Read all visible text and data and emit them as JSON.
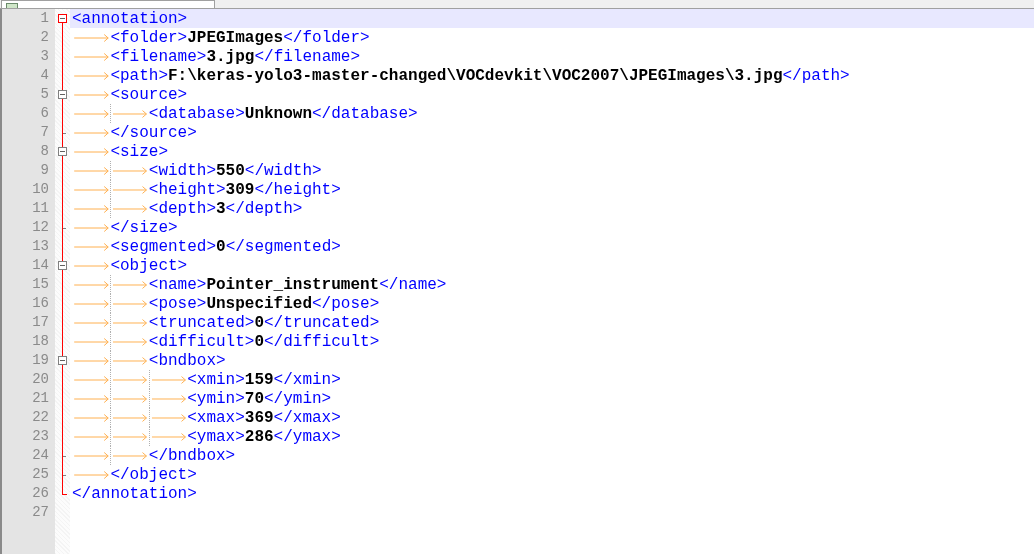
{
  "editor": {
    "lines": [
      {
        "number": "1",
        "current": true,
        "open": [
          {
            "kind": "tag",
            "text": "<annotation>"
          }
        ],
        "close_number": "26",
        "close": [
          {
            "kind": "tag",
            "text": "</annotation>"
          }
        ],
        "children": [
          {
            "number": "2",
            "current": false,
            "open": [
              {
                "kind": "tag",
                "text": "<folder>"
              },
              {
                "kind": "text",
                "text": "JPEGImages"
              },
              {
                "kind": "tag",
                "text": "</folder>"
              }
            ]
          },
          {
            "number": "3",
            "current": false,
            "open": [
              {
                "kind": "tag",
                "text": "<filename>"
              },
              {
                "kind": "text",
                "text": "3.jpg"
              },
              {
                "kind": "tag",
                "text": "</filename>"
              }
            ]
          },
          {
            "number": "4",
            "current": false,
            "open": [
              {
                "kind": "tag",
                "text": "<path>"
              },
              {
                "kind": "text",
                "text": "F:\\keras-yolo3-master-changed\\VOCdevkit\\VOC2007\\JPEGImages\\3.jpg"
              },
              {
                "kind": "tag",
                "text": "</path>"
              }
            ]
          },
          {
            "number": "5",
            "current": false,
            "open": [
              {
                "kind": "tag",
                "text": "<source>"
              }
            ],
            "close_number": "7",
            "close": [
              {
                "kind": "tag",
                "text": "</source>"
              }
            ],
            "children": [
              {
                "number": "6",
                "current": false,
                "open": [
                  {
                    "kind": "tag",
                    "text": "<database>"
                  },
                  {
                    "kind": "text",
                    "text": "Unknown"
                  },
                  {
                    "kind": "tag",
                    "text": "</database>"
                  }
                ]
              }
            ]
          },
          {
            "number": "8",
            "current": false,
            "open": [
              {
                "kind": "tag",
                "text": "<size>"
              }
            ],
            "close_number": "12",
            "close": [
              {
                "kind": "tag",
                "text": "</size>"
              }
            ],
            "children": [
              {
                "number": "9",
                "current": false,
                "open": [
                  {
                    "kind": "tag",
                    "text": "<width>"
                  },
                  {
                    "kind": "text",
                    "text": "550"
                  },
                  {
                    "kind": "tag",
                    "text": "</width>"
                  }
                ]
              },
              {
                "number": "10",
                "current": false,
                "open": [
                  {
                    "kind": "tag",
                    "text": "<height>"
                  },
                  {
                    "kind": "text",
                    "text": "309"
                  },
                  {
                    "kind": "tag",
                    "text": "</height>"
                  }
                ]
              },
              {
                "number": "11",
                "current": false,
                "open": [
                  {
                    "kind": "tag",
                    "text": "<depth>"
                  },
                  {
                    "kind": "text",
                    "text": "3"
                  },
                  {
                    "kind": "tag",
                    "text": "</depth>"
                  }
                ]
              }
            ]
          },
          {
            "number": "13",
            "current": false,
            "open": [
              {
                "kind": "tag",
                "text": "<segmented>"
              },
              {
                "kind": "text",
                "text": "0"
              },
              {
                "kind": "tag",
                "text": "</segmented>"
              }
            ]
          },
          {
            "number": "14",
            "current": false,
            "open": [
              {
                "kind": "tag",
                "text": "<object>"
              }
            ],
            "close_number": "25",
            "close": [
              {
                "kind": "tag",
                "text": "</object>"
              }
            ],
            "children": [
              {
                "number": "15",
                "current": false,
                "open": [
                  {
                    "kind": "tag",
                    "text": "<name>"
                  },
                  {
                    "kind": "text",
                    "text": "Pointer_instrument"
                  },
                  {
                    "kind": "tag",
                    "text": "</name>"
                  }
                ]
              },
              {
                "number": "16",
                "current": false,
                "open": [
                  {
                    "kind": "tag",
                    "text": "<pose>"
                  },
                  {
                    "kind": "text",
                    "text": "Unspecified"
                  },
                  {
                    "kind": "tag",
                    "text": "</pose>"
                  }
                ]
              },
              {
                "number": "17",
                "current": false,
                "open": [
                  {
                    "kind": "tag",
                    "text": "<truncated>"
                  },
                  {
                    "kind": "text",
                    "text": "0"
                  },
                  {
                    "kind": "tag",
                    "text": "</truncated>"
                  }
                ]
              },
              {
                "number": "18",
                "current": false,
                "open": [
                  {
                    "kind": "tag",
                    "text": "<difficult>"
                  },
                  {
                    "kind": "text",
                    "text": "0"
                  },
                  {
                    "kind": "tag",
                    "text": "</difficult>"
                  }
                ]
              },
              {
                "number": "19",
                "current": false,
                "open": [
                  {
                    "kind": "tag",
                    "text": "<bndbox>"
                  }
                ],
                "close_number": "24",
                "close": [
                  {
                    "kind": "tag",
                    "text": "</bndbox>"
                  }
                ],
                "children": [
                  {
                    "number": "20",
                    "current": false,
                    "open": [
                      {
                        "kind": "tag",
                        "text": "<xmin>"
                      },
                      {
                        "kind": "text",
                        "text": "159"
                      },
                      {
                        "kind": "tag",
                        "text": "</xmin>"
                      }
                    ]
                  },
                  {
                    "number": "21",
                    "current": false,
                    "open": [
                      {
                        "kind": "tag",
                        "text": "<ymin>"
                      },
                      {
                        "kind": "text",
                        "text": "70"
                      },
                      {
                        "kind": "tag",
                        "text": "</ymin>"
                      }
                    ]
                  },
                  {
                    "number": "22",
                    "current": false,
                    "open": [
                      {
                        "kind": "tag",
                        "text": "<xmax>"
                      },
                      {
                        "kind": "text",
                        "text": "369"
                      },
                      {
                        "kind": "tag",
                        "text": "</xmax>"
                      }
                    ]
                  },
                  {
                    "number": "23",
                    "current": false,
                    "open": [
                      {
                        "kind": "tag",
                        "text": "<ymax>"
                      },
                      {
                        "kind": "text",
                        "text": "286"
                      },
                      {
                        "kind": "tag",
                        "text": "</ymax>"
                      }
                    ]
                  }
                ]
              }
            ]
          }
        ]
      },
      {
        "number": "27",
        "current": false
      }
    ]
  }
}
